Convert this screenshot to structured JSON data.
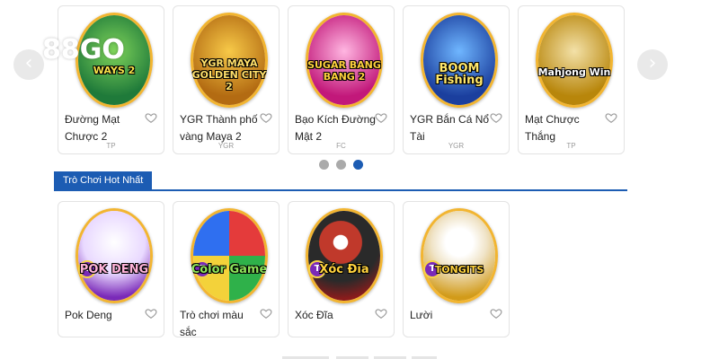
{
  "brand": {
    "logo_text": "88GO"
  },
  "carousel": {
    "prev_icon": "‹",
    "next_icon": "›",
    "dots": [
      {
        "active": false,
        "color": "#aaaaaa"
      },
      {
        "active": false,
        "color": "#aaaaaa"
      },
      {
        "active": true,
        "color": "#1c5cb3"
      }
    ],
    "games": [
      {
        "art_title": "WAYS 2",
        "name": "Đường Mạt Chược 2",
        "provider": "TP"
      },
      {
        "art_title": "YGR MAYA GOLDEN CITY 2",
        "name": "YGR Thành phố vàng Maya 2",
        "provider": "YGR"
      },
      {
        "art_title": "SUGAR BANG BANG 2",
        "name": "Bạo Kích Đường Mật 2",
        "provider": "FC"
      },
      {
        "art_title": "BOOM Fishing",
        "name": "YGR Bắn Cá Nổ Tài",
        "provider": "YGR"
      },
      {
        "art_title": "Mahjong Win",
        "name": "Mạt Chược Thắng",
        "provider": "TP"
      }
    ]
  },
  "hot_section": {
    "title": "Trò Chơi Hot Nhất",
    "games": [
      {
        "art_title": "POK DENG",
        "name": "Pok Deng"
      },
      {
        "art_title": "Color Game",
        "name": "Trò chơi màu sắc"
      },
      {
        "art_title": "Xóc Đĩa",
        "name": "Xóc Đĩa"
      },
      {
        "art_title": "TONGITS",
        "name": "Lười"
      }
    ]
  },
  "colors": {
    "accent": "#1c5cb3",
    "ring": "#f2b531"
  }
}
